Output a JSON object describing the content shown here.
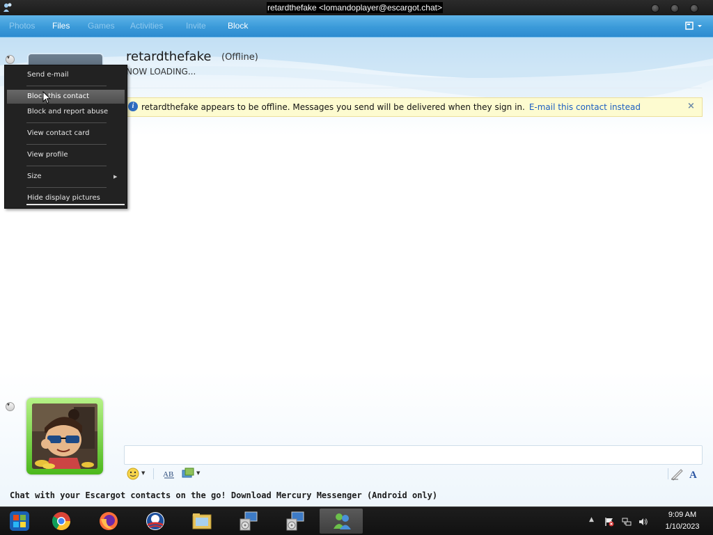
{
  "window": {
    "title": "retardthefake <lomandoplayer@escargot.chat>"
  },
  "menubar": {
    "items": [
      {
        "label": "Photos",
        "enabled": false
      },
      {
        "label": "Files",
        "enabled": true
      },
      {
        "label": "Games",
        "enabled": false
      },
      {
        "label": "Activities",
        "enabled": false
      },
      {
        "label": "Invite",
        "enabled": false
      },
      {
        "label": "Block",
        "enabled": true
      }
    ]
  },
  "contact": {
    "name": "retardthefake",
    "status": "(Offline)",
    "personal_message": "NOW LOADING..."
  },
  "infobar": {
    "message": "retardthefake appears to be offline. Messages you send will be delivered when they sign in.",
    "link": "E-mail this contact instead",
    "close": "×"
  },
  "context_menu": {
    "items": [
      {
        "label": "Send e-mail"
      },
      {
        "label": "Block this contact",
        "highlighted": true
      },
      {
        "label": "Block and report abuse"
      },
      {
        "label": "View contact card"
      },
      {
        "label": "View profile"
      },
      {
        "label": "Size",
        "submenu": true
      },
      {
        "label": "Hide display pictures"
      }
    ]
  },
  "footer": {
    "ad_text": "Chat with your Escargot contacts on the go! Download Mercury Messenger (Android only)"
  },
  "taskbar": {
    "items": [
      "start-orb",
      "chrome",
      "firefox",
      "obama-logo",
      "file-explorer",
      "setup-installer",
      "setup-installer-2",
      "messenger"
    ],
    "clock_time": "9:09 AM",
    "clock_date": "1/10/2023"
  },
  "colors": {
    "accent": "#3a9ad9",
    "link": "#1d5fc2",
    "infobar_bg": "#fdfbd0",
    "menu_bg": "#222222",
    "dp_frame": "#4cb81c"
  }
}
